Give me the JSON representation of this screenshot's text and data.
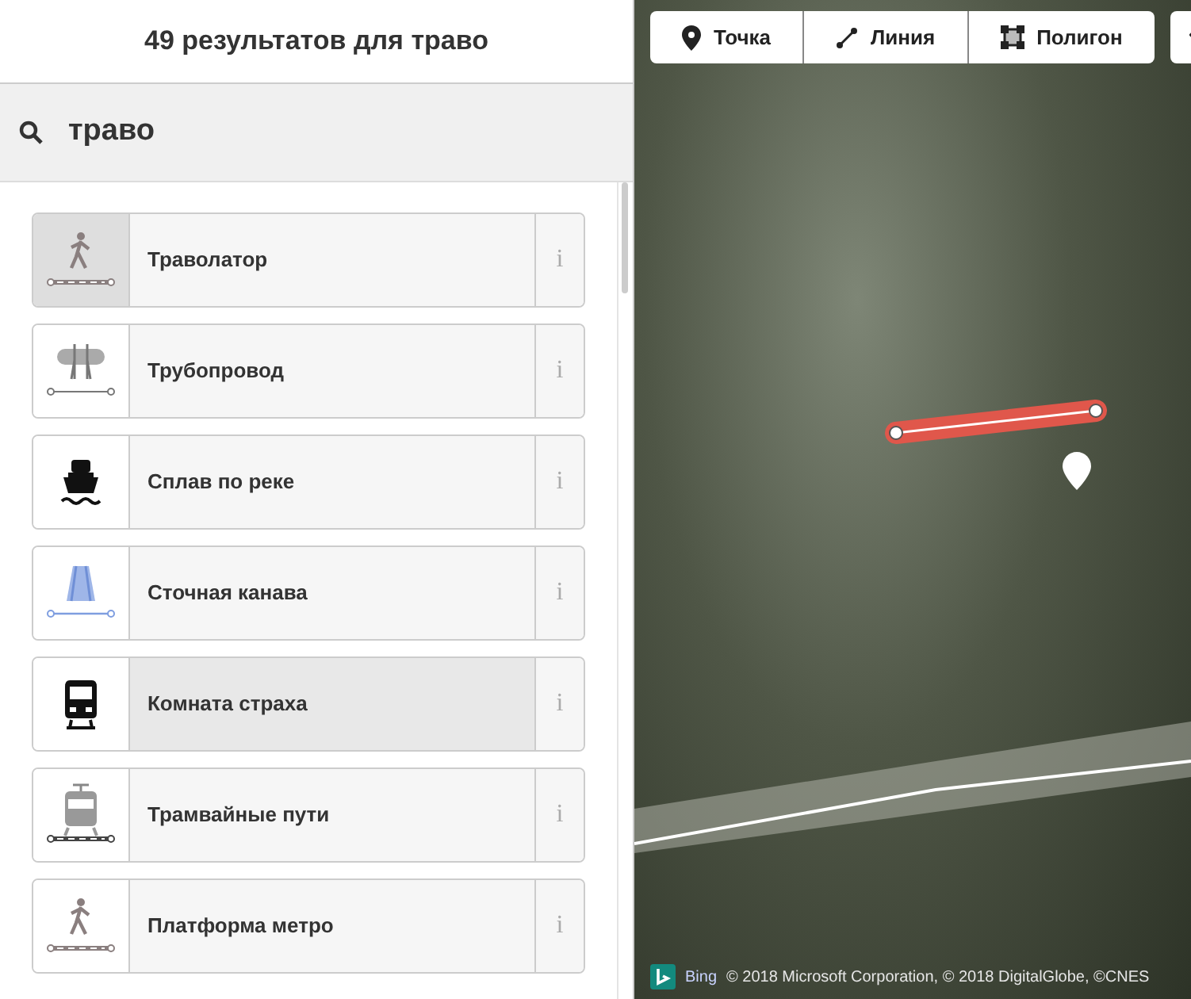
{
  "header": {
    "title": "49 результатов для траво"
  },
  "search": {
    "value": "траво"
  },
  "results": [
    {
      "kind": "walker",
      "label": "Траволатор",
      "info": "i",
      "focused": true,
      "hovered": false
    },
    {
      "kind": "pipeline",
      "label": "Трубопровод",
      "info": "i",
      "focused": false,
      "hovered": false
    },
    {
      "kind": "ferry",
      "label": "Сплав по реке",
      "info": "i",
      "focused": false,
      "hovered": false
    },
    {
      "kind": "drain",
      "label": "Сточная канава",
      "info": "i",
      "focused": false,
      "hovered": false
    },
    {
      "kind": "train",
      "label": "Комната страха",
      "info": "i",
      "focused": false,
      "hovered": true
    },
    {
      "kind": "tram",
      "label": "Трамвайные пути",
      "info": "i",
      "focused": false,
      "hovered": false
    },
    {
      "kind": "walker",
      "label": "Платформа метро",
      "info": "i",
      "focused": false,
      "hovered": false
    }
  ],
  "toolbar": [
    {
      "kind": "point",
      "label": "Точка"
    },
    {
      "kind": "line",
      "label": "Линия"
    },
    {
      "kind": "area",
      "label": "Полигон"
    }
  ],
  "attribution": {
    "brand": "Bing",
    "text": "© 2018 Microsoft Corporation, © 2018 DigitalGlobe, ©CNES"
  }
}
